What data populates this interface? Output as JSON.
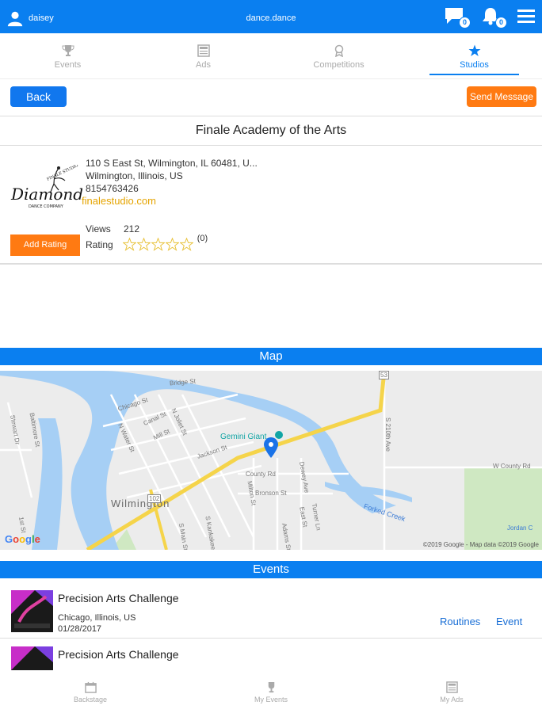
{
  "header": {
    "username": "daisey",
    "app_title": "dance.dance",
    "messages_count": "0",
    "notifications_count": "0"
  },
  "tabs": [
    {
      "label": "Events",
      "icon": "trophy-icon"
    },
    {
      "label": "Ads",
      "icon": "newspaper-icon"
    },
    {
      "label": "Competitions",
      "icon": "ribbon-icon"
    },
    {
      "label": "Studios",
      "icon": "star-icon",
      "active": true
    }
  ],
  "actions": {
    "back_label": "Back",
    "send_message_label": "Send Message"
  },
  "studio": {
    "name": "Finale Academy of the Arts",
    "address_line1": "110 S East St, Wilmington, IL 60481, U...",
    "address_line2": "Wilmington, Illinois, US",
    "phone": "8154763426",
    "website": "finalestudio.com",
    "logo_text_top": "FINALE STUDIO",
    "logo_text_main": "Diamond",
    "logo_text_sub": "DANCE COMPANY",
    "add_rating_label": "Add Rating",
    "views_label": "Views",
    "views_value": "212",
    "rating_label": "Rating",
    "rating_stars": 0,
    "rating_max": 5,
    "rating_count": "(0)"
  },
  "map": {
    "title": "Map",
    "labels": {
      "town": "Wilmington",
      "poi": "Gemini Giant",
      "creek": "Forked Creek",
      "county_rd": "County Rd",
      "w_county_rd": "W County Rd",
      "jackson": "Jackson St",
      "mill": "Mill St",
      "canal": "Canal St",
      "chicago": "Chicago St",
      "water": "N Water St",
      "joliet": "N Joliet St",
      "bronson": "Bronson St",
      "dewey": "Dewey Ave",
      "bridge": "Bridge St",
      "kankakee": "S Kankakee St",
      "main": "S Main St",
      "adams": "Adams St",
      "route53": "53",
      "route102": "102",
      "ave210": "S 210th Ave",
      "jordan": "Jordan C",
      "stewart": "Stewart Dr",
      "baltimore": "Baltimore St",
      "first": "1st St",
      "turner": "Turner Ln",
      "eastst": "East St",
      "milton": "Milton St"
    },
    "google_logo": "Google",
    "copyright": "©2019 Google - Map data ©2019 Google"
  },
  "events_section": {
    "title": "Events",
    "items": [
      {
        "name": "Precision Arts Challenge",
        "location": "Chicago, Illinois, US",
        "date": "01/28/2017",
        "routines_label": "Routines",
        "event_label": "Event"
      },
      {
        "name": "Precision Arts Challenge"
      }
    ]
  },
  "bottom_nav": [
    {
      "label": "Backstage",
      "icon": "calendar-icon"
    },
    {
      "label": "My Events",
      "icon": "trophy-icon"
    },
    {
      "label": "My Ads",
      "icon": "newspaper-icon"
    }
  ],
  "colors": {
    "primary": "#0a7ff0",
    "accent_orange": "#ff7a12",
    "website_gold": "#e5a400",
    "map_water": "#a6cff5",
    "map_road": "#f5d44a",
    "map_park": "#cfe8c2"
  }
}
